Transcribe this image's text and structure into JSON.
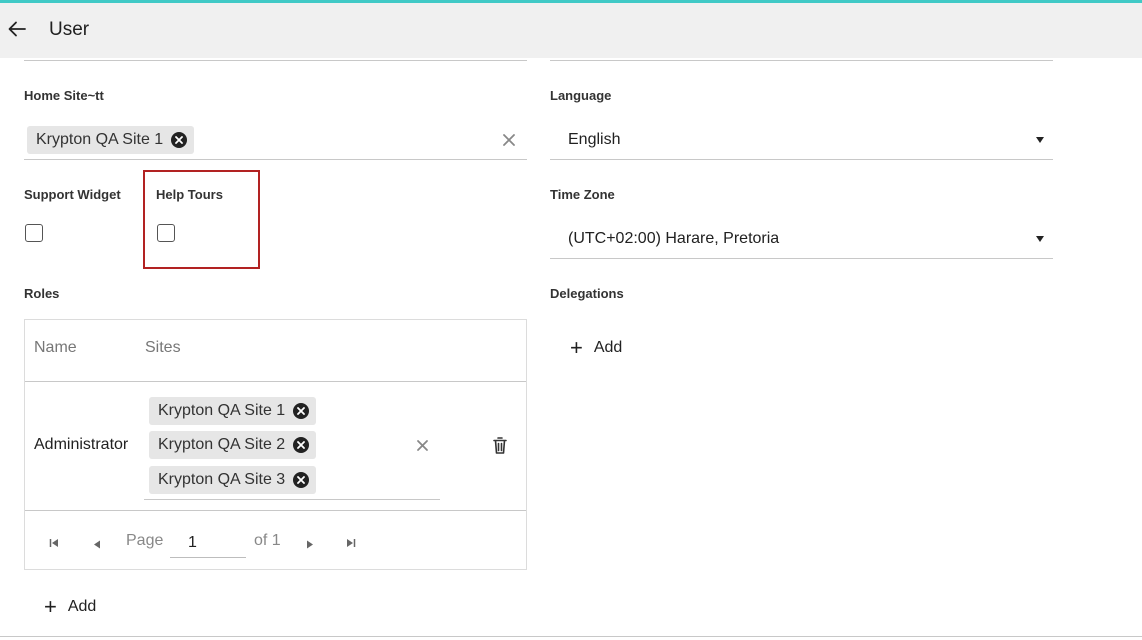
{
  "header": {
    "title": "User"
  },
  "left": {
    "home_site": {
      "label": "Home Site~tt",
      "chips": [
        "Krypton QA Site 1"
      ]
    },
    "support_widget": {
      "label": "Support Widget",
      "checked": false
    },
    "help_tours": {
      "label": "Help Tours",
      "checked": false
    },
    "roles": {
      "label": "Roles",
      "columns": [
        "Name",
        "Sites"
      ],
      "rows": [
        {
          "name": "Administrator",
          "sites": [
            "Krypton QA Site 1",
            "Krypton QA Site 2",
            "Krypton QA Site 3"
          ]
        }
      ],
      "pager": {
        "page_label": "Page",
        "page_value": "1",
        "of_label": "of 1"
      },
      "add_label": "Add"
    }
  },
  "right": {
    "language": {
      "label": "Language",
      "value": "English"
    },
    "time_zone": {
      "label": "Time Zone",
      "value": "(UTC+02:00) Harare, Pretoria"
    },
    "delegations": {
      "label": "Delegations",
      "add_label": "Add"
    }
  },
  "colors": {
    "accent_line": "#40c9c6",
    "highlight": "#b22222",
    "header_bg": "#f0f0f0"
  }
}
